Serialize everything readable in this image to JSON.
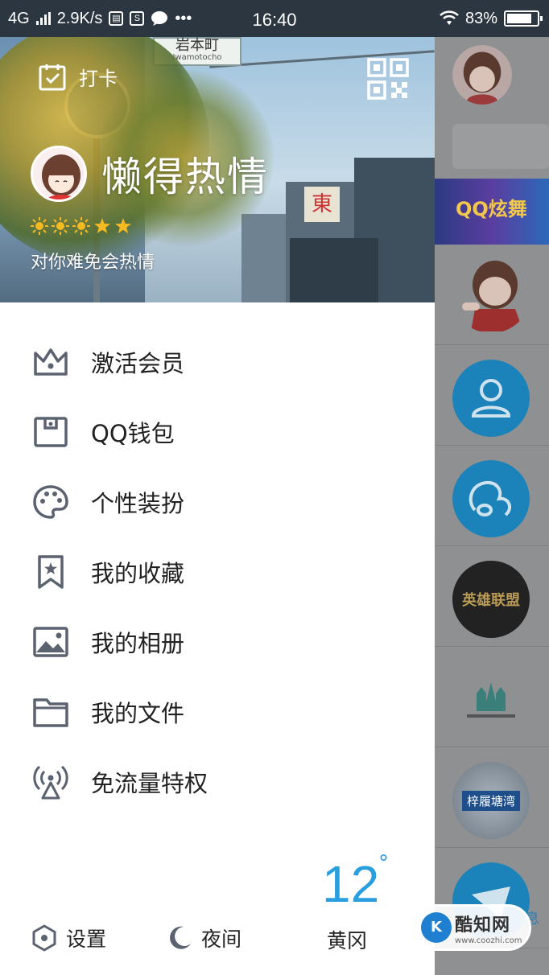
{
  "status_bar": {
    "network": "4G",
    "speed": "2.9K/s",
    "more": "•••",
    "time": "16:40",
    "battery_text": "83%",
    "battery_level": 0.83
  },
  "header": {
    "checkin_label": "打卡",
    "nickname": "懒得热情",
    "signature": "对你难免会热情",
    "level_icons": [
      "sun-icon",
      "sun-icon",
      "sun-icon",
      "star-icon",
      "star-icon"
    ],
    "background_scene": {
      "sign_text": "岩本町",
      "sign_romaji": "Iwamotocho",
      "building_sign": "東"
    }
  },
  "menu": {
    "items": [
      {
        "label": "激活会员",
        "icon": "crown-icon"
      },
      {
        "label": "QQ钱包",
        "icon": "wallet-icon"
      },
      {
        "label": "个性装扮",
        "icon": "palette-icon"
      },
      {
        "label": "我的收藏",
        "icon": "bookmark-star-icon"
      },
      {
        "label": "我的相册",
        "icon": "image-icon"
      },
      {
        "label": "我的文件",
        "icon": "folder-icon"
      },
      {
        "label": "免流量特权",
        "icon": "antenna-icon"
      }
    ]
  },
  "footer": {
    "settings_label": "设置",
    "night_label": "夜间",
    "weather": {
      "temp": "12",
      "degree": "°",
      "city": "黄冈"
    }
  },
  "right_panel": {
    "banner_text": "QQ炫舞",
    "bottom_tab": "消息",
    "game_tile_text": "英雄联盟",
    "photo_tile_text": "梓履塘湾"
  },
  "watermark": {
    "logo": "K",
    "name": "酷知网",
    "url": "www.coozhi.com"
  },
  "colors": {
    "accent": "#2a9fe0",
    "status_bar": "#2b3640",
    "icon_gray": "#5b6270",
    "overlay": "#8f9092"
  }
}
